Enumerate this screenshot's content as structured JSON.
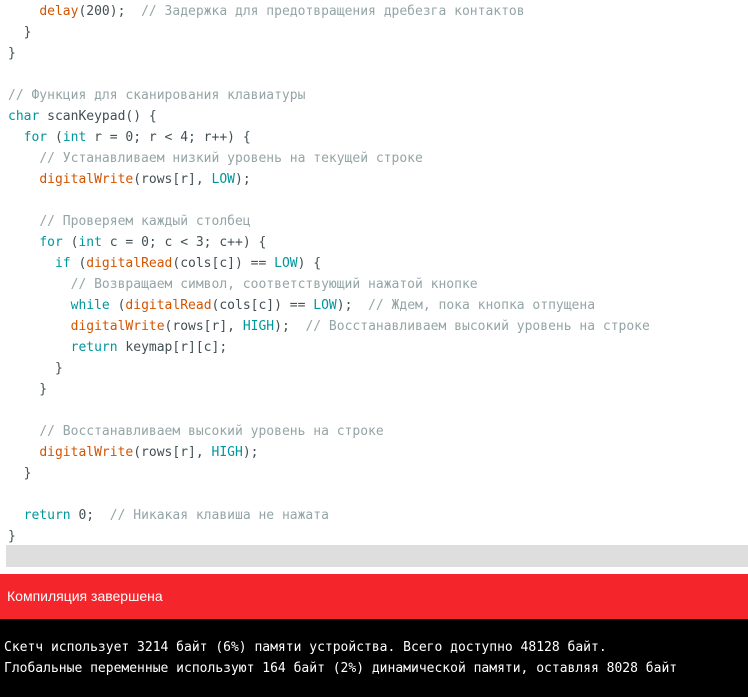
{
  "editor": {
    "lines": [
      [
        [
          "    ",
          "p"
        ],
        [
          "delay",
          "f"
        ],
        [
          "(200);  ",
          "p"
        ],
        [
          "// Задержка для предотвращения дребезга контактов",
          "m"
        ]
      ],
      [
        [
          "  }",
          "p"
        ]
      ],
      [
        [
          "}",
          "p"
        ]
      ],
      [],
      [
        [
          "// Функция для сканирования клавиатуры",
          "m"
        ]
      ],
      [
        [
          "char",
          "k"
        ],
        [
          " scanKeypad() {",
          "p"
        ]
      ],
      [
        [
          "  ",
          "p"
        ],
        [
          "for",
          "k"
        ],
        [
          " (",
          "p"
        ],
        [
          "int",
          "k"
        ],
        [
          " r = 0; r < 4; r++) {",
          "p"
        ]
      ],
      [
        [
          "    ",
          "p"
        ],
        [
          "// Устанавливаем низкий уровень на текущей строке",
          "m"
        ]
      ],
      [
        [
          "    ",
          "p"
        ],
        [
          "digitalWrite",
          "f"
        ],
        [
          "(rows[r], ",
          "p"
        ],
        [
          "LOW",
          "k"
        ],
        [
          ");",
          "p"
        ]
      ],
      [],
      [
        [
          "    ",
          "p"
        ],
        [
          "// Проверяем каждый столбец",
          "m"
        ]
      ],
      [
        [
          "    ",
          "p"
        ],
        [
          "for",
          "k"
        ],
        [
          " (",
          "p"
        ],
        [
          "int",
          "k"
        ],
        [
          " c = 0; c < 3; c++) {",
          "p"
        ]
      ],
      [
        [
          "      ",
          "p"
        ],
        [
          "if",
          "k"
        ],
        [
          " (",
          "p"
        ],
        [
          "digitalRead",
          "f"
        ],
        [
          "(cols[c]) == ",
          "p"
        ],
        [
          "LOW",
          "k"
        ],
        [
          ") {",
          "p"
        ]
      ],
      [
        [
          "        ",
          "p"
        ],
        [
          "// Возвращаем символ, соответствующий нажатой кнопке",
          "m"
        ]
      ],
      [
        [
          "        ",
          "p"
        ],
        [
          "while",
          "k"
        ],
        [
          " (",
          "p"
        ],
        [
          "digitalRead",
          "f"
        ],
        [
          "(cols[c]) == ",
          "p"
        ],
        [
          "LOW",
          "k"
        ],
        [
          ");  ",
          "p"
        ],
        [
          "// Ждем, пока кнопка отпущена",
          "m"
        ]
      ],
      [
        [
          "        ",
          "p"
        ],
        [
          "digitalWrite",
          "f"
        ],
        [
          "(rows[r], ",
          "p"
        ],
        [
          "HIGH",
          "k"
        ],
        [
          ");  ",
          "p"
        ],
        [
          "// Восстанавливаем высокий уровень на строке",
          "m"
        ]
      ],
      [
        [
          "        ",
          "p"
        ],
        [
          "return",
          "k"
        ],
        [
          " keymap[r][c];",
          "p"
        ]
      ],
      [
        [
          "      }",
          "p"
        ]
      ],
      [
        [
          "    }",
          "p"
        ]
      ],
      [],
      [
        [
          "    ",
          "p"
        ],
        [
          "// Восстанавливаем высокий уровень на строке",
          "m"
        ]
      ],
      [
        [
          "    ",
          "p"
        ],
        [
          "digitalWrite",
          "f"
        ],
        [
          "(rows[r], ",
          "p"
        ],
        [
          "HIGH",
          "k"
        ],
        [
          ");",
          "p"
        ]
      ],
      [
        [
          "  }",
          "p"
        ]
      ],
      [],
      [
        [
          "  ",
          "p"
        ],
        [
          "return",
          "k"
        ],
        [
          " 0;  ",
          "p"
        ],
        [
          "// Никакая клавиша не нажата",
          "m"
        ]
      ],
      [
        [
          "}",
          "p"
        ]
      ]
    ]
  },
  "status": {
    "text": "Компиляция завершена"
  },
  "console": {
    "lines": [
      "Скетч использует 3214 байт (6%) памяти устройства. Всего доступно 48128 байт.",
      "Глобальные переменные используют 164 байт (2%) динамической памяти, оставляя 8028 байт"
    ]
  },
  "colors": {
    "status_bar": "#f4252b",
    "keyword": "#00979c",
    "function": "#d35400",
    "comment": "#95a5a6",
    "plain": "#434f54",
    "console_bg": "#000000"
  }
}
